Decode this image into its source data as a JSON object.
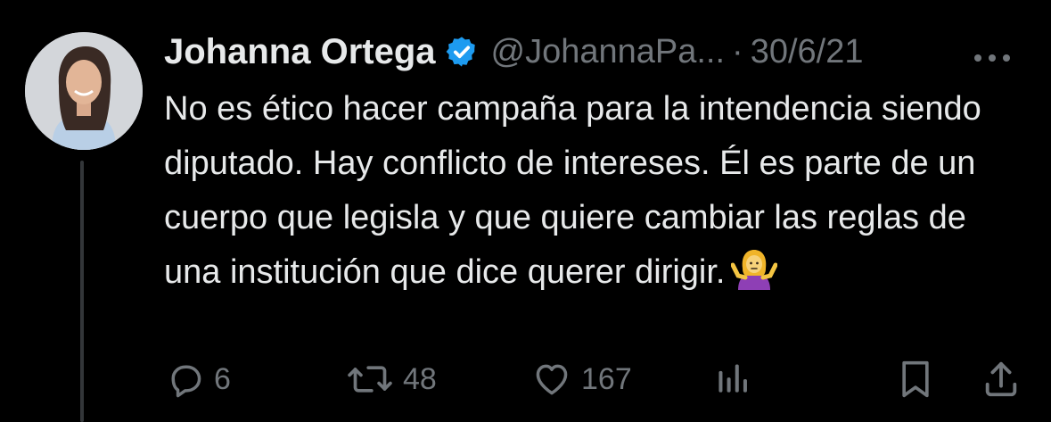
{
  "tweet": {
    "author_name": "Johanna Ortega",
    "handle": "@JohannaPa...",
    "separator": "·",
    "date": "30/6/21",
    "more_icon": "more-horizontal-icon",
    "text": "No es ético hacer campaña para la intendencia siendo diputado. Hay conflicto de intereses. Él es parte de un cuerpo que legisla y que quiere cambiar las reglas de una institución que dice querer dirigir.",
    "emoji": "person-shrugging-emoji",
    "verified_color": "#1d9bf0"
  },
  "actions": {
    "reply": {
      "icon": "reply-icon",
      "count": "6"
    },
    "retweet": {
      "icon": "retweet-icon",
      "count": "48"
    },
    "like": {
      "icon": "heart-icon",
      "count": "167"
    },
    "views": {
      "icon": "analytics-icon"
    },
    "bookmark": {
      "icon": "bookmark-icon"
    },
    "share": {
      "icon": "share-icon"
    }
  },
  "colors": {
    "background": "#000000",
    "text": "#e7e9ea",
    "secondary": "#71767b",
    "thread_line": "#333639"
  }
}
